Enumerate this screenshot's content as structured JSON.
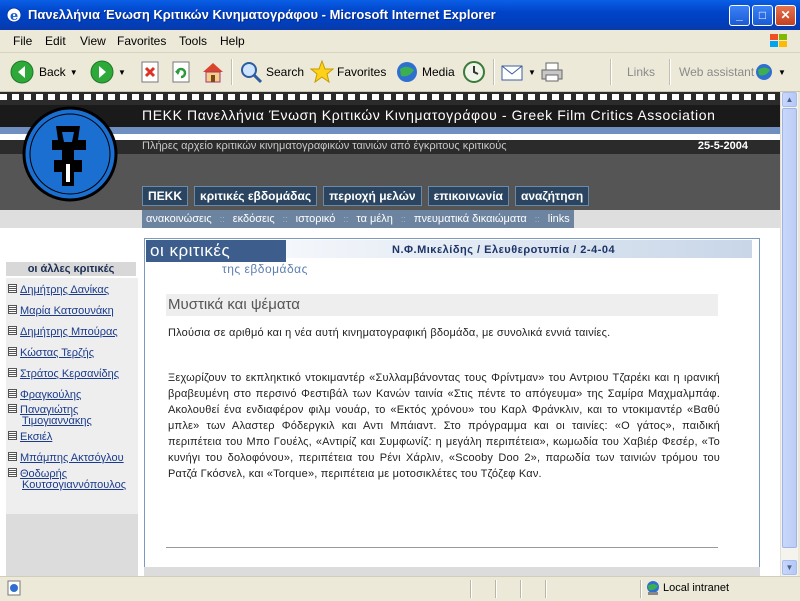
{
  "window": {
    "title": "Πανελλήνια Ένωση Κριτικών Κινηματογράφου - Microsoft Internet Explorer"
  },
  "menu": [
    "File",
    "Edit",
    "View",
    "Favorites",
    "Tools",
    "Help"
  ],
  "toolbar": {
    "back": "Back",
    "search": "Search",
    "favorites": "Favorites",
    "media": "Media",
    "links": "Links",
    "web_assistant": "Web assistant"
  },
  "site": {
    "header_title": "ΠΕΚΚ Πανελλήνια Ένωση Κριτικών Κινηματογράφου - Greek Film Critics Association",
    "subtitle": "Πλήρες αρχείο κριτικών κινηματογραφικών ταινιών από έγκριτους κριτικούς",
    "date": "25-5-2004",
    "main_nav": [
      "ΠΕΚΚ",
      "κριτικές εβδομάδας",
      "περιοχή μελών",
      "επικοινωνία",
      "αναζήτηση"
    ],
    "sub_nav": [
      "ανακοινώσεις",
      "εκδόσεις",
      "ιστορικό",
      "τα μέλη",
      "πνευματικά δικαιώματα",
      "links"
    ]
  },
  "sidebar": {
    "heading": "οι άλλες κριτικές",
    "critics": [
      "Δημήτρης Δανίκας",
      "Μαρία Κατσουνάκη",
      "Δημήτρης Μπούρας",
      "Κώστας Τερζής",
      "Στράτος Κερσανίδης",
      "Φραγκούλης",
      "Παναγιώτης Τιμογιαννάκης",
      "Εκσιέλ",
      "Μπάμπης Ακτσόγλου",
      "Θοδωρής Κουτσογιαννόπουλος"
    ]
  },
  "panel": {
    "title": "οι κριτικές",
    "subtitle": "της εβδομάδας",
    "byline": "Ν.Φ.Μικελίδης / Ελευθεροτυπία / 2-4-04"
  },
  "article": {
    "title": "Μυστικά και ψέματα",
    "paragraphs": [
      "Πλούσια σε αριθμό και η νέα αυτή κινηματογραφική βδομάδα, με συνολικά εννιά ταινίες.",
      "Ξεχωρίζουν το εκπληκτικό ντοκιμαντέρ «Συλλαμβάνοντας τους Φρίντμαν» του Αντριου Τζαρέκι και η ιρανική βραβευμένη στο περσινό Φεστιβάλ των Κανών ταινία «Στις πέντε το απόγευμα» της Σαμίρα Μαχμαλμπάφ. Ακολουθεί ένα ενδιαφέρον φιλμ νουάρ, το «Εκτός χρόνου» του Καρλ Φράνκλιν, και το ντοκιμαντέρ «Βαθύ μπλε» των Αλαστερ Φόδεργκιλ και Αντι Μπάιαντ. Στο πρόγραμμα και οι ταινίες: «Ο γάτος», παιδική περιπέτεια του Μπο Γουέλς, «Αντιρίζ και Συμφωνίζ: η μεγάλη περιπέτεια», κωμωδία του Χαβιέρ Φεσέρ, «Το κυνήγι του δολοφόνου», περιπέτεια του Ρένι Χάρλιν, «Scooby Doo 2», παρωδία των ταινιών τρόμου του Ρατζά Γκόσνελ, και «Torque», περιπέτεια με μοτοσικλέτες του Τζόζεφ Καν."
    ]
  },
  "status": {
    "zone": "Local intranet"
  }
}
